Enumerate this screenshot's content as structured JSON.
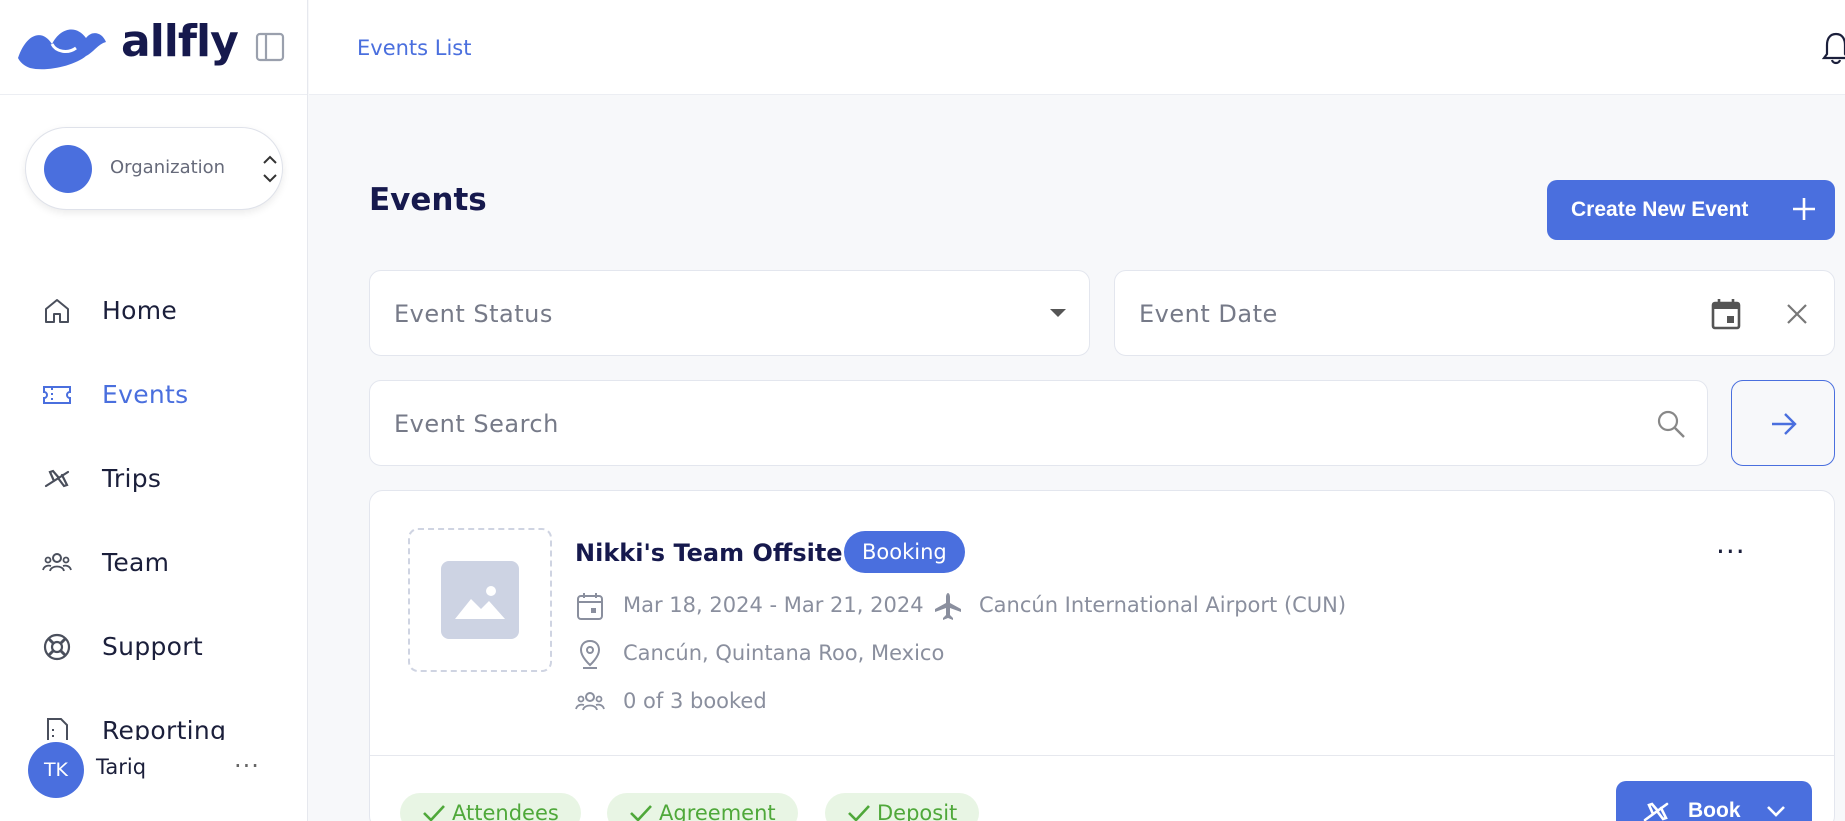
{
  "brand": {
    "wordmark": "allfly"
  },
  "org": {
    "label": "Organization"
  },
  "sidebar": {
    "items": [
      {
        "label": "Home",
        "icon": "home-icon"
      },
      {
        "label": "Events",
        "icon": "ticket-icon",
        "active": true
      },
      {
        "label": "Trips",
        "icon": "plane-icon"
      },
      {
        "label": "Team",
        "icon": "team-icon"
      },
      {
        "label": "Support",
        "icon": "lifebuoy-icon"
      },
      {
        "label": "Reporting",
        "icon": "report-icon"
      }
    ]
  },
  "user": {
    "initials": "TK",
    "name": "Tariq",
    "more": "···"
  },
  "topbar": {
    "breadcrumb": "Events List"
  },
  "main": {
    "title": "Events",
    "create_label": "Create New Event",
    "filters": {
      "status_placeholder": "Event Status",
      "date_placeholder": "Event Date",
      "search_placeholder": "Event Search"
    }
  },
  "event": {
    "title": "Nikki's Team Offsite",
    "status": "Booking",
    "dates": "Mar 18, 2024 - Mar 21, 2024",
    "airport": "Cancún International Airport (CUN)",
    "location": "Cancún, Quintana Roo, Mexico",
    "booked": "0 of 3 booked",
    "menu": "···",
    "checks": [
      "Attendees",
      "Agreement",
      "Deposit"
    ],
    "book_label": "Book"
  },
  "colors": {
    "accent": "#4a6fde",
    "navy": "#16194d",
    "success": "#4fa83a"
  }
}
